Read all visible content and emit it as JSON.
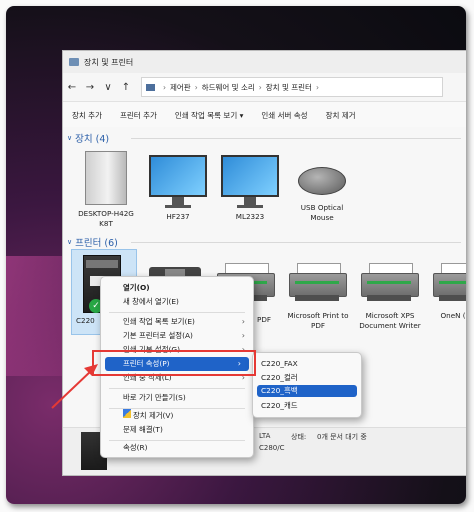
{
  "window": {
    "title": "장치 및 프린터"
  },
  "nav": {
    "back_icon": "←",
    "forward_icon": "→",
    "dropdown_icon": "∨",
    "up_icon": "↑",
    "breadcrumb": [
      "제어판",
      "하드웨어 및 소리",
      "장치 및 프린터"
    ],
    "sep": "›"
  },
  "commands": [
    "장치 추가",
    "프린터 추가",
    "인쇄 작업 목록 보기 ▾",
    "인쇄 서버 속성",
    "장치 제거"
  ],
  "devices_section": {
    "chevron": "∨",
    "label": "장치 (4)"
  },
  "devices": [
    {
      "name_line1": "DESKTOP-H42G",
      "name_line2": "K8T"
    },
    {
      "name_line1": "HF237",
      "name_line2": ""
    },
    {
      "name_line1": "ML2323",
      "name_line2": ""
    },
    {
      "name_line1": "USB Optical",
      "name_line2": "Mouse"
    }
  ],
  "printers_section": {
    "chevron": "∨",
    "label": "프린터 (6)"
  },
  "printers": [
    {
      "label": "C220",
      "partial": "C220"
    },
    {
      "label": "",
      "partial": "PDF"
    },
    {
      "label": "Microsoft Print to PDF"
    },
    {
      "label": "Microsoft XPS Document Writer"
    },
    {
      "label": "OneN (Desk",
      "partial": "OneN\n(Desk"
    }
  ],
  "check_icon": "✓",
  "context_menu": {
    "items": [
      {
        "label": "열기(O)",
        "bold": true
      },
      {
        "label": "새 창에서 열기(E)"
      },
      {
        "label": "인쇄 작업 목록 보기(E)",
        "arrow": "›"
      },
      {
        "label": "기본 프린터로 설정(A)",
        "arrow": "›"
      },
      {
        "label": "인쇄 기본 설정(G)",
        "arrow": "›"
      },
      {
        "label": "프린터 속성(P)",
        "arrow": "›"
      },
      {
        "label": "인쇄 중 삭제(L)",
        "arrow": "›"
      },
      {
        "label": "바로 가기 만들기(S)"
      },
      {
        "label": "장치 제거(V)"
      },
      {
        "label": "문제 해결(T)"
      },
      {
        "label": "속성(R)"
      }
    ]
  },
  "submenu": {
    "items": [
      "C220_FAX",
      "C220_컬러",
      "C220_흑백",
      "C220_캐드"
    ],
    "selected_index": 2
  },
  "details": {
    "model_fragment": "LTA",
    "status_label": "상태:",
    "status_value": "0개 문서 대기 중",
    "model_line2": "C280/C"
  },
  "colors": {
    "accent": "#1f63c8",
    "highlight_box": "#e53935",
    "section": "#2a5ea8"
  }
}
